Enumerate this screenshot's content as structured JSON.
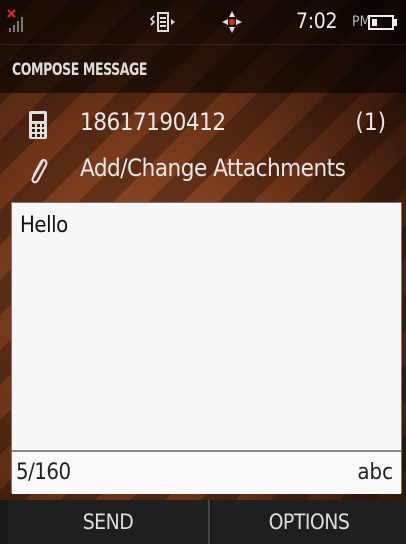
{
  "status_bar": {
    "time": "7:02",
    "ampm": "PM",
    "icons": [
      "no-signal-icon",
      "vibrate-icon",
      "gps-icon",
      "battery-icon"
    ]
  },
  "header": {
    "title": "COMPOSE MESSAGE"
  },
  "recipient": {
    "number": "18617190412",
    "count": "(1)"
  },
  "attachments": {
    "label": "Add/Change Attachments"
  },
  "editor": {
    "text": "Hello",
    "char_counter": "5/160",
    "input_mode": "abc"
  },
  "softkeys": {
    "left": "SEND",
    "right": "OPTIONS"
  },
  "colors": {
    "signal_x": "#d93025",
    "editor_bg": "#f7f7f7"
  }
}
